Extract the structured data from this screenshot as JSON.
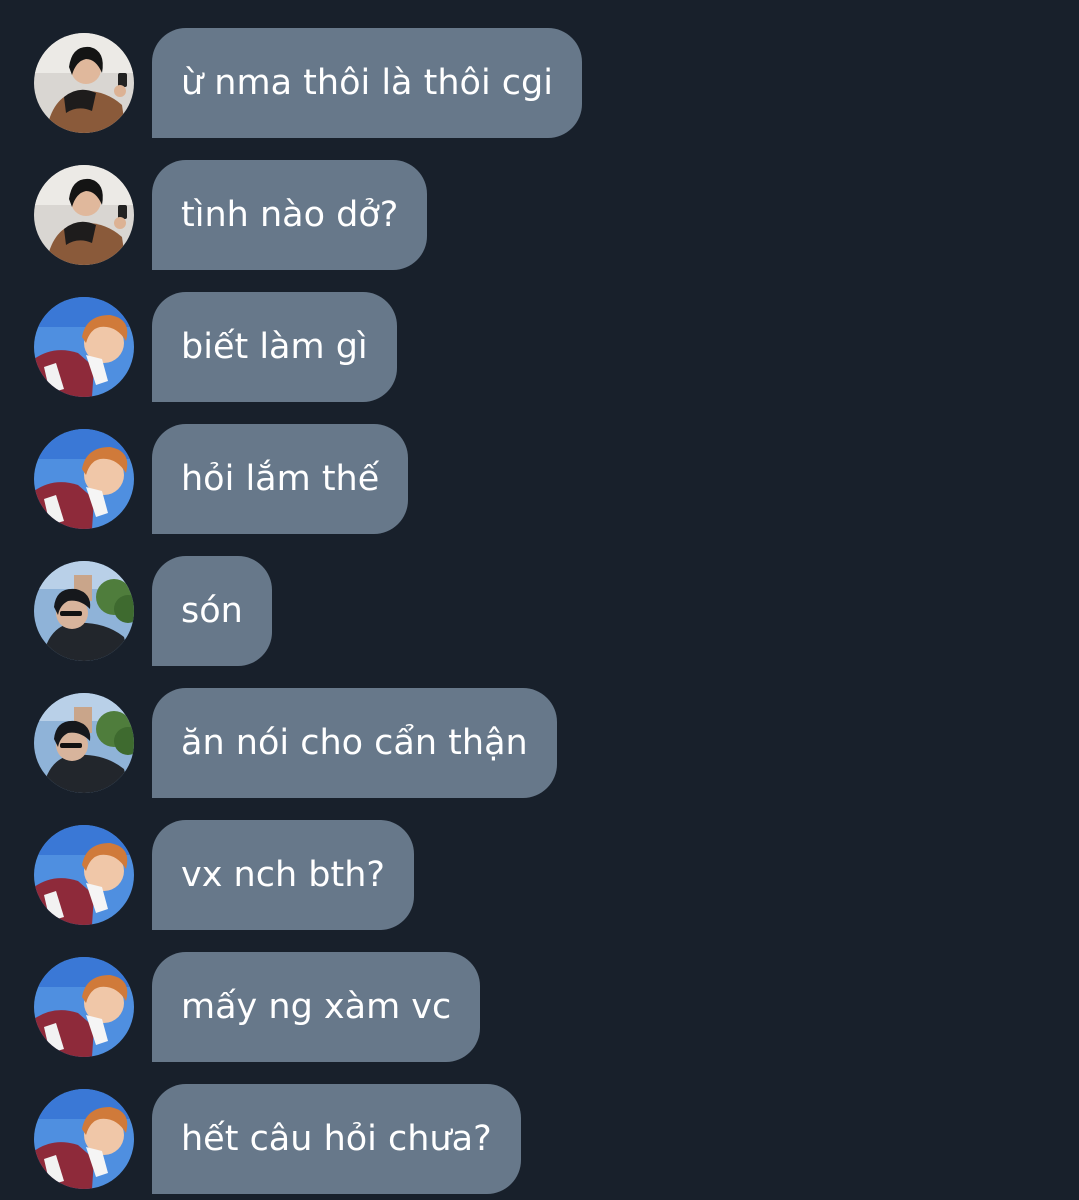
{
  "colors": {
    "background": "#18202b",
    "bubble": "#67788a",
    "text": "#ffffff"
  },
  "messages": [
    {
      "avatar": "avatar-a",
      "text": "ừ nma thôi là thôi cgi"
    },
    {
      "avatar": "avatar-a",
      "text": "tình nào dở?"
    },
    {
      "avatar": "avatar-b",
      "text": "biết làm gì"
    },
    {
      "avatar": "avatar-b",
      "text": "hỏi lắm thế"
    },
    {
      "avatar": "avatar-c",
      "text": "són"
    },
    {
      "avatar": "avatar-c",
      "text": "ăn nói cho cẩn thận"
    },
    {
      "avatar": "avatar-b",
      "text": "vx nch bth?"
    },
    {
      "avatar": "avatar-b",
      "text": "mấy ng xàm vc"
    },
    {
      "avatar": "avatar-b",
      "text": "hết câu hỏi chưa?"
    }
  ]
}
